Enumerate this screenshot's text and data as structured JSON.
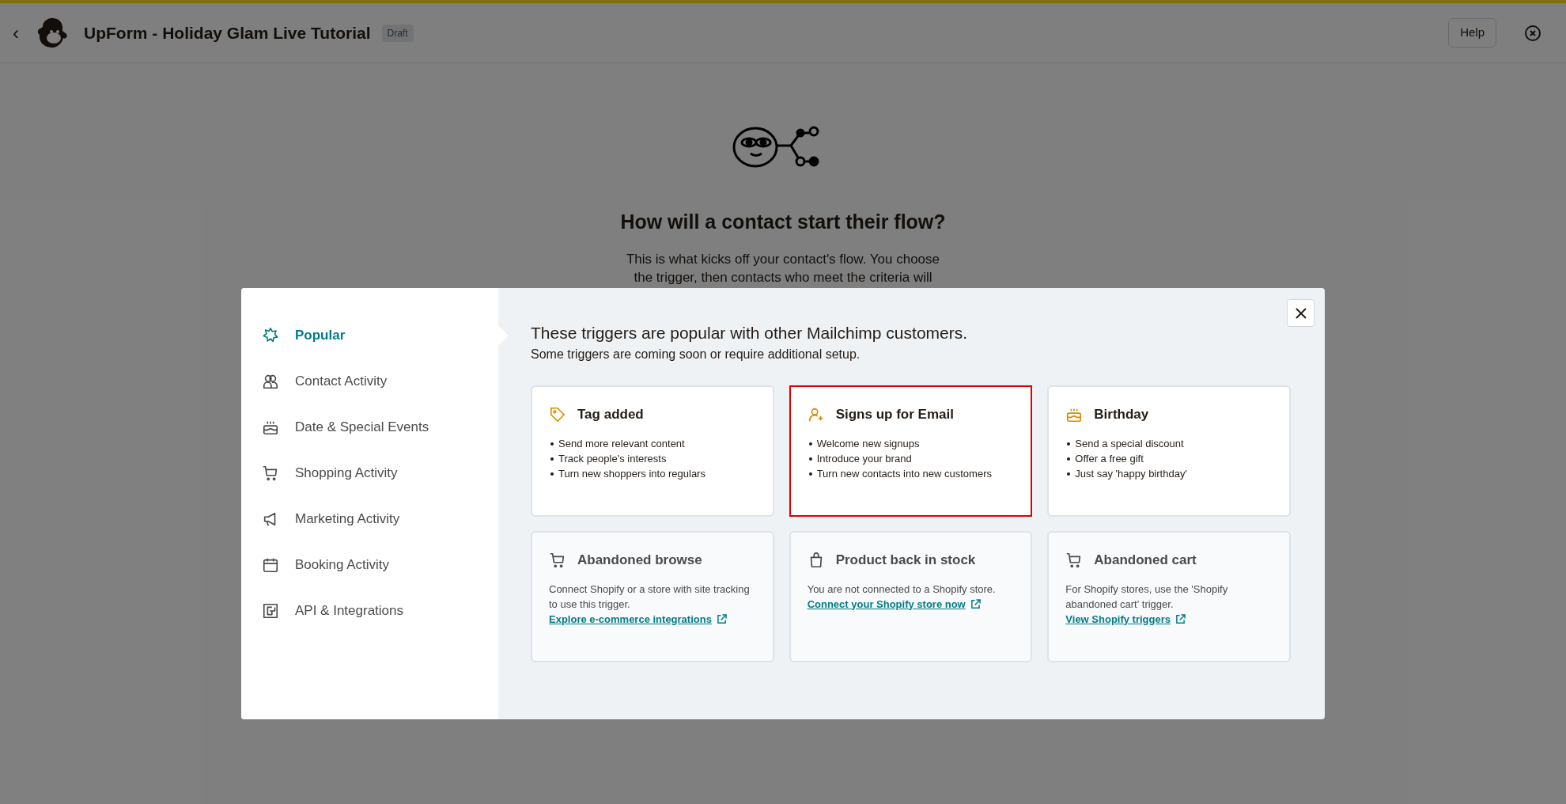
{
  "header": {
    "back": "‹",
    "title": "UpForm - Holiday Glam Live Tutorial",
    "badge": "Draft",
    "help": "Help"
  },
  "intro": {
    "heading": "How will a contact start their flow?",
    "lines": [
      "This is what kicks off your contact's flow. You choose",
      "the trigger, then contacts who meet the criteria will"
    ]
  },
  "modal": {
    "sidebar": [
      {
        "label": "Popular",
        "selected": true
      },
      {
        "label": "Contact Activity",
        "selected": false
      },
      {
        "label": "Date & Special Events",
        "selected": false
      },
      {
        "label": "Shopping Activity",
        "selected": false
      },
      {
        "label": "Marketing Activity",
        "selected": false
      },
      {
        "label": "Booking Activity",
        "selected": false
      },
      {
        "label": "API & Integrations",
        "selected": false
      }
    ],
    "heading": "These triggers are popular with other Mailchimp customers.",
    "subheading": "Some triggers are coming soon or require additional setup.",
    "cards": [
      {
        "kind": "trigger",
        "title": "Tag added",
        "highlighted": false,
        "bullets": [
          "Send more relevant content",
          "Track people's interests",
          "Turn new shoppers into regulars"
        ]
      },
      {
        "kind": "trigger",
        "title": "Signs up for Email",
        "highlighted": true,
        "bullets": [
          "Welcome new signups",
          "Introduce your brand",
          "Turn new contacts into new customers"
        ]
      },
      {
        "kind": "trigger",
        "title": "Birthday",
        "highlighted": false,
        "bullets": [
          "Send a special discount",
          "Offer a free gift",
          "Just say 'happy birthday'"
        ]
      },
      {
        "kind": "setup",
        "title": "Abandoned browse",
        "text": "Connect Shopify or a store with site tracking to use this trigger.",
        "link": "Explore e-commerce integrations"
      },
      {
        "kind": "setup",
        "title": "Product back in stock",
        "text": "You are not connected to a Shopify store.",
        "link": "Connect your Shopify store now"
      },
      {
        "kind": "setup",
        "title": "Abandoned cart",
        "text": "For Shopify stores, use the 'Shopify abandoned cart' trigger.",
        "link": "View Shopify triggers"
      }
    ]
  }
}
